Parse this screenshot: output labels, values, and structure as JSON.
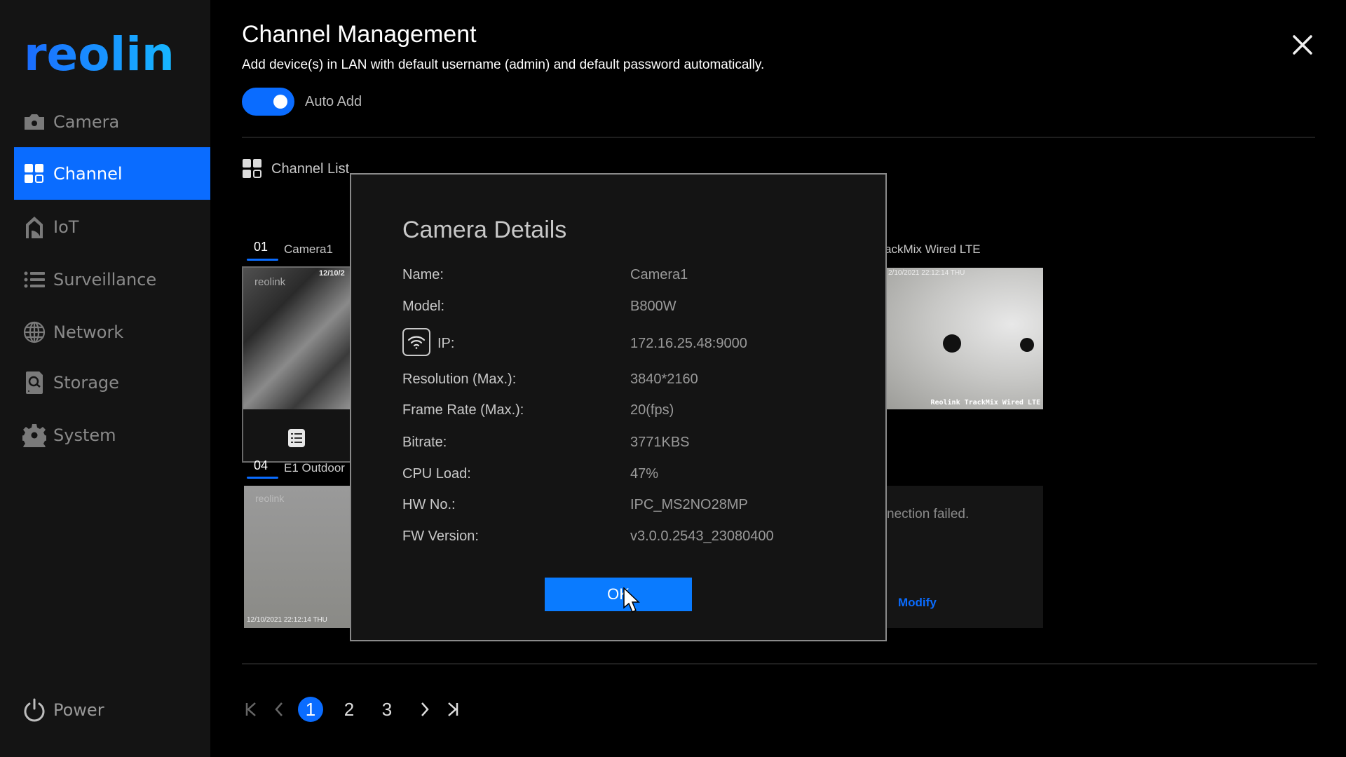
{
  "brand": {
    "logo_text": "reolink",
    "color": "#1e90ff"
  },
  "sidebar": {
    "items": [
      {
        "label": "Camera",
        "icon": "camera-icon",
        "active": false
      },
      {
        "label": "Channel",
        "icon": "channel-grid-icon",
        "active": true
      },
      {
        "label": "IoT",
        "icon": "iot-home-icon",
        "active": false
      },
      {
        "label": "Surveillance",
        "icon": "list-icon",
        "active": false
      },
      {
        "label": "Network",
        "icon": "globe-icon",
        "active": false
      },
      {
        "label": "Storage",
        "icon": "storage-icon",
        "active": false
      },
      {
        "label": "System",
        "icon": "gear-icon",
        "active": false
      }
    ],
    "power_label": "Power"
  },
  "header": {
    "title": "Channel Management",
    "subtitle": "Add device(s) in LAN with default username (admin) and default password automatically.",
    "auto_add_label": "Auto Add",
    "auto_add_on": true
  },
  "channel_list": {
    "title": "Channel List",
    "tiles": [
      {
        "number": "01",
        "name": "Camera1",
        "overlay_date": "12/10/2",
        "watermark": "reolink"
      },
      {
        "number": "04",
        "name": "E1 Outdoor",
        "overlay_date": "12/10/2021 22:12:14 THU",
        "watermark": "reolink"
      },
      {
        "name_partial": "ackMix Wired LTE",
        "overlay_text": "Reolink TrackMix Wired LTE",
        "overlay_date": "2/10/2021 22:12:14 THU"
      },
      {
        "status_partial": "nection failed.",
        "action_label": "Modify"
      }
    ]
  },
  "dialog": {
    "title": "Camera Details",
    "rows": [
      {
        "label": "Name:",
        "value": "Camera1"
      },
      {
        "label": "Model:",
        "value": "B800W"
      },
      {
        "label": "IP:",
        "value": "172.16.25.48:9000",
        "icon": "wifi-icon"
      },
      {
        "label": "Resolution (Max.):",
        "value": "3840*2160"
      },
      {
        "label": "Frame Rate (Max.):",
        "value": "20(fps)"
      },
      {
        "label": "Bitrate:",
        "value": "3771KBS"
      },
      {
        "label": "CPU Load:",
        "value": "47%"
      },
      {
        "label": "HW No.:",
        "value": "IPC_MS2NO28MP"
      },
      {
        "label": "FW Version:",
        "value": "v3.0.0.2543_23080400"
      }
    ],
    "ok_label": "OK"
  },
  "pagination": {
    "pages": [
      "1",
      "2",
      "3"
    ],
    "current": "1",
    "first_icon": "first-page-icon",
    "prev_icon": "prev-page-icon",
    "next_icon": "next-page-icon",
    "last_icon": "last-page-icon"
  },
  "colors": {
    "accent": "#0a6cff",
    "sidebar_bg": "#141414",
    "dialog_bg": "#141414",
    "page_bg": "#000000"
  }
}
